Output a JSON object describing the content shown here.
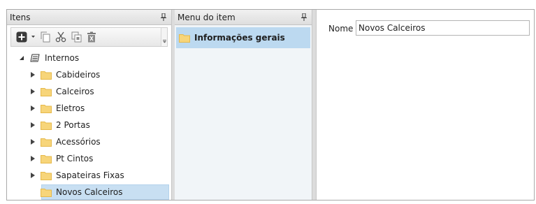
{
  "itens_panel": {
    "title": "Itens",
    "tree": {
      "root_label": "Internos",
      "children": [
        {
          "label": "Cabideiros"
        },
        {
          "label": "Calceiros"
        },
        {
          "label": "Eletros"
        },
        {
          "label": "2 Portas"
        },
        {
          "label": "Acessórios"
        },
        {
          "label": "Pt Cintos"
        },
        {
          "label": "Sapateiras Fixas"
        },
        {
          "label": "Novos Calceiros"
        }
      ],
      "selected": "Novos Calceiros"
    },
    "toolbar_icons": [
      "add-icon",
      "dropdown-caret-icon",
      "copy-icon",
      "cut-icon",
      "duplicate-icon",
      "delete-icon"
    ]
  },
  "menu_panel": {
    "title": "Menu do item",
    "items": [
      {
        "label": "Informações gerais"
      }
    ]
  },
  "detail_panel": {
    "nome_label": "Nome",
    "nome_value": "Novos Calceiros"
  },
  "colors": {
    "selection": "#c8dff2",
    "menu_selection": "#bcd9f0",
    "folder": "#f7d57a"
  }
}
